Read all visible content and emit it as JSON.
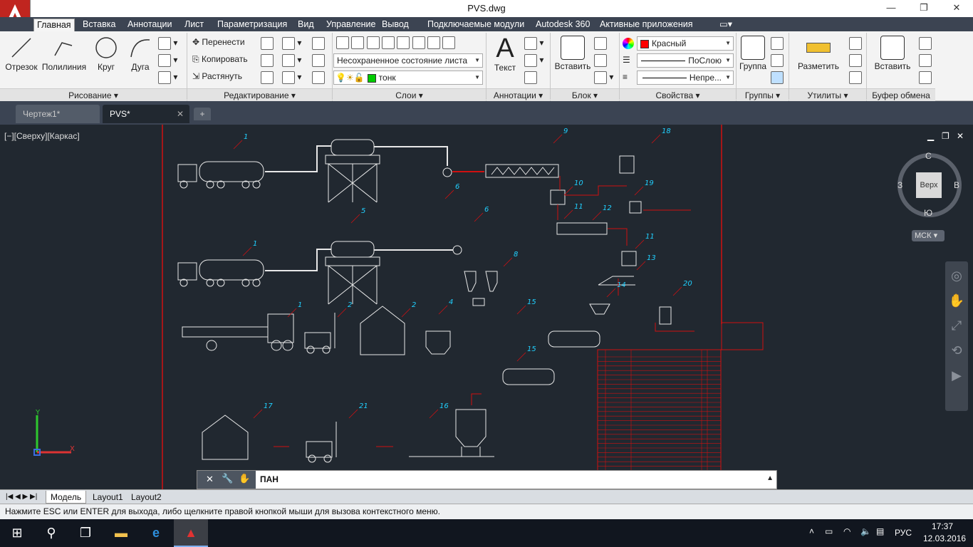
{
  "window": {
    "title": "PVS.dwg",
    "minimize": "—",
    "maximize": "❐",
    "close": "✕"
  },
  "ribbon_tabs": [
    "Главная",
    "Вставка",
    "Аннотации",
    "Лист",
    "Параметризация",
    "Вид",
    "Управление",
    "Вывод",
    "Подключаемые модули",
    "Autodesk 360",
    "Активные приложения"
  ],
  "draw_panel": {
    "title": "Рисование",
    "line": "Отрезок",
    "polyline": "Полилиния",
    "circle": "Круг",
    "arc": "Дуга"
  },
  "modify_panel": {
    "title": "Редактирование",
    "move": "Перенести",
    "copy": "Копировать",
    "stretch": "Растянуть"
  },
  "layers_panel": {
    "title": "Слои",
    "state": "Несохраненное состояние листа",
    "layer": "тонк"
  },
  "annot_panel": {
    "title": "Аннотации",
    "text": "Текст"
  },
  "block_panel": {
    "title": "Блок",
    "insert": "Вставить"
  },
  "props_panel": {
    "title": "Свойства",
    "color": "Красный",
    "linetype": "ПоСлою",
    "lineweight": "Непре..."
  },
  "groups_panel": {
    "title": "Группы",
    "group": "Группа"
  },
  "utils_panel": {
    "title": "Утилиты",
    "measure": "Разметить"
  },
  "clipboard_panel": {
    "title": "Буфер обмена",
    "paste": "Вставить"
  },
  "doc_tabs": [
    "Чертеж1*",
    "PVS*"
  ],
  "viewport_label": "[−][Сверху][Каркас]",
  "viewcube": {
    "top": "Верх",
    "n": "С",
    "s": "Ю",
    "e": "В",
    "w": "З",
    "ucs": "МСК"
  },
  "command": {
    "text": "ПАН"
  },
  "layout_tabs": [
    "Модель",
    "Layout1",
    "Layout2"
  ],
  "status": "Нажмите ESC или ENTER для выхода, либо щелкните правой кнопкой мыши для вызова контекстного меню.",
  "tray": {
    "lang": "РУС",
    "time": "17:37",
    "date": "12.03.2016"
  },
  "drawing_labels": [
    "1",
    "1",
    "1",
    "2",
    "2",
    "4",
    "5",
    "6",
    "6",
    "8",
    "9",
    "10",
    "11",
    "11",
    "12",
    "13",
    "14",
    "15",
    "15",
    "16",
    "17",
    "18",
    "19",
    "20",
    "21"
  ],
  "colors": {
    "accent": "#c0251f",
    "canvas": "#212830",
    "red_line": "#d01010",
    "cyan_text": "#20d0ff"
  }
}
